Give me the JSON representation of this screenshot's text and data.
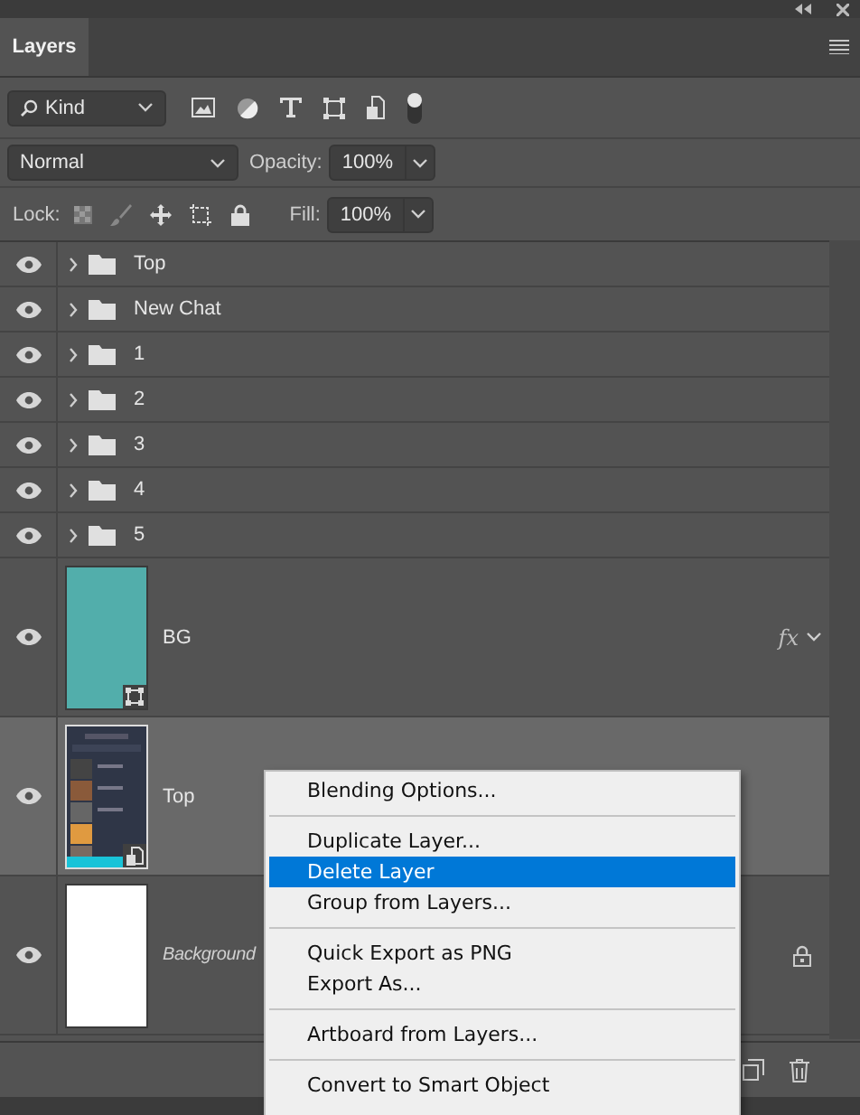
{
  "panel": {
    "tab": "Layers"
  },
  "filter": {
    "kind": "Kind"
  },
  "blend": {
    "mode": "Normal",
    "opacity_label": "Opacity:",
    "opacity": "100%"
  },
  "lock": {
    "label": "Lock:",
    "fill_label": "Fill:",
    "fill": "100%"
  },
  "layers": [
    {
      "kind": "group",
      "name": "Top",
      "visible": true,
      "selected": false
    },
    {
      "kind": "group",
      "name": "New Chat",
      "visible": true,
      "selected": false
    },
    {
      "kind": "group",
      "name": "1",
      "visible": true,
      "selected": false
    },
    {
      "kind": "group",
      "name": "2",
      "visible": true,
      "selected": false
    },
    {
      "kind": "group",
      "name": "3",
      "visible": true,
      "selected": false
    },
    {
      "kind": "group",
      "name": "4",
      "visible": true,
      "selected": false
    },
    {
      "kind": "group",
      "name": "5",
      "visible": true,
      "selected": false
    },
    {
      "kind": "shape",
      "name": "BG",
      "visible": true,
      "selected": false,
      "effects": "fx"
    },
    {
      "kind": "smart",
      "name": "Top",
      "visible": true,
      "selected": true
    },
    {
      "kind": "background",
      "name": "Background",
      "visible": true,
      "selected": false,
      "locked": true
    }
  ],
  "context_menu": [
    {
      "kind": "item",
      "label": "Blending Options...",
      "selected": false
    },
    {
      "kind": "separator"
    },
    {
      "kind": "item",
      "label": "Duplicate Layer...",
      "selected": false
    },
    {
      "kind": "item",
      "label": "Delete Layer",
      "selected": true
    },
    {
      "kind": "item",
      "label": "Group from Layers...",
      "selected": false
    },
    {
      "kind": "separator"
    },
    {
      "kind": "item",
      "label": "Quick Export as PNG",
      "selected": false
    },
    {
      "kind": "item",
      "label": "Export As...",
      "selected": false
    },
    {
      "kind": "separator"
    },
    {
      "kind": "item",
      "label": "Artboard from Layers...",
      "selected": false
    },
    {
      "kind": "separator"
    },
    {
      "kind": "item",
      "label": "Convert to Smart Object",
      "selected": false
    }
  ]
}
